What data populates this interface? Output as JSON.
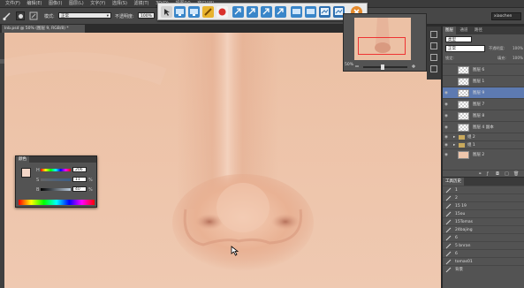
{
  "menu": [
    "文件(F)",
    "编辑(E)",
    "图像(I)",
    "图层(L)",
    "文字(Y)",
    "选择(S)",
    "滤镜(T)",
    "3D(D)",
    "视图(V)",
    "窗口(W)"
  ],
  "options": {
    "mode_label": "模式:",
    "mode_value": "正常",
    "opacity_label": "不透明度:",
    "opacity_value": "100%"
  },
  "workspace_name": "xiaochen",
  "doc_tab": "lnb.psd @ 50% (图层 9, RGB/8) *",
  "float_toolbar": {
    "icon_names": [
      "select-icon",
      "monitor-icon",
      "monitor-icon",
      "pencil-icon",
      "record-icon",
      "arrow-icon",
      "arrow-icon",
      "arrow-icon",
      "arrow-icon",
      "monitor-icon",
      "monitor-icon",
      "screen-icon",
      "screen-icon",
      "close-icon"
    ],
    "colors": [
      "#d0d0d0",
      "#3a86c9",
      "#3a86c9",
      "#e8b32e",
      "#d9302b",
      "#3a86c9",
      "#3a86c9",
      "#3a86c9",
      "#3a86c9",
      "#3a86c9",
      "#3a86c9",
      "#2e6fb0",
      "#2e6fb0",
      "#e58a2c"
    ]
  },
  "navigator": {
    "zoom": "50%"
  },
  "layers_panel": {
    "tabs": [
      "图层",
      "通道",
      "路径"
    ],
    "kind_label": "类型",
    "blend_mode": "正常",
    "opacity_label": "不透明度:",
    "opacity_value": "100%",
    "lock_label": "锁定:",
    "fill_label": "填充:",
    "fill_value": "100%",
    "rows": [
      {
        "name": "图层 6",
        "visible": false,
        "selected": false,
        "type": "layer"
      },
      {
        "name": "图层 1",
        "visible": false,
        "selected": false,
        "type": "layer"
      },
      {
        "name": "图层 9",
        "visible": true,
        "selected": true,
        "type": "layer"
      },
      {
        "name": "图层 7",
        "visible": true,
        "selected": false,
        "type": "layer"
      },
      {
        "name": "图层 8",
        "visible": true,
        "selected": false,
        "type": "layer"
      },
      {
        "name": "图层 4 副本",
        "visible": true,
        "selected": false,
        "type": "layer"
      },
      {
        "name": "组 2",
        "visible": true,
        "selected": false,
        "type": "group"
      },
      {
        "name": "组 1",
        "visible": true,
        "selected": false,
        "type": "group"
      },
      {
        "name": "图层 2",
        "visible": true,
        "selected": false,
        "type": "layer"
      }
    ]
  },
  "history_panel": {
    "title": "工具历史",
    "rows": [
      "1",
      "2",
      "15 19",
      "15ou",
      "15Tomas",
      "24bajing",
      "6",
      "5 bnran",
      "6",
      "tomas01",
      "背景"
    ]
  },
  "color_panel": {
    "title": "颜色",
    "fg_color": "#f2d6c8",
    "bg_color": "#ffffff",
    "channels": [
      {
        "label": "H",
        "value": "206"
      },
      {
        "label": "S",
        "value": "11"
      },
      {
        "label": "B",
        "value": "40"
      }
    ],
    "units": "%"
  }
}
